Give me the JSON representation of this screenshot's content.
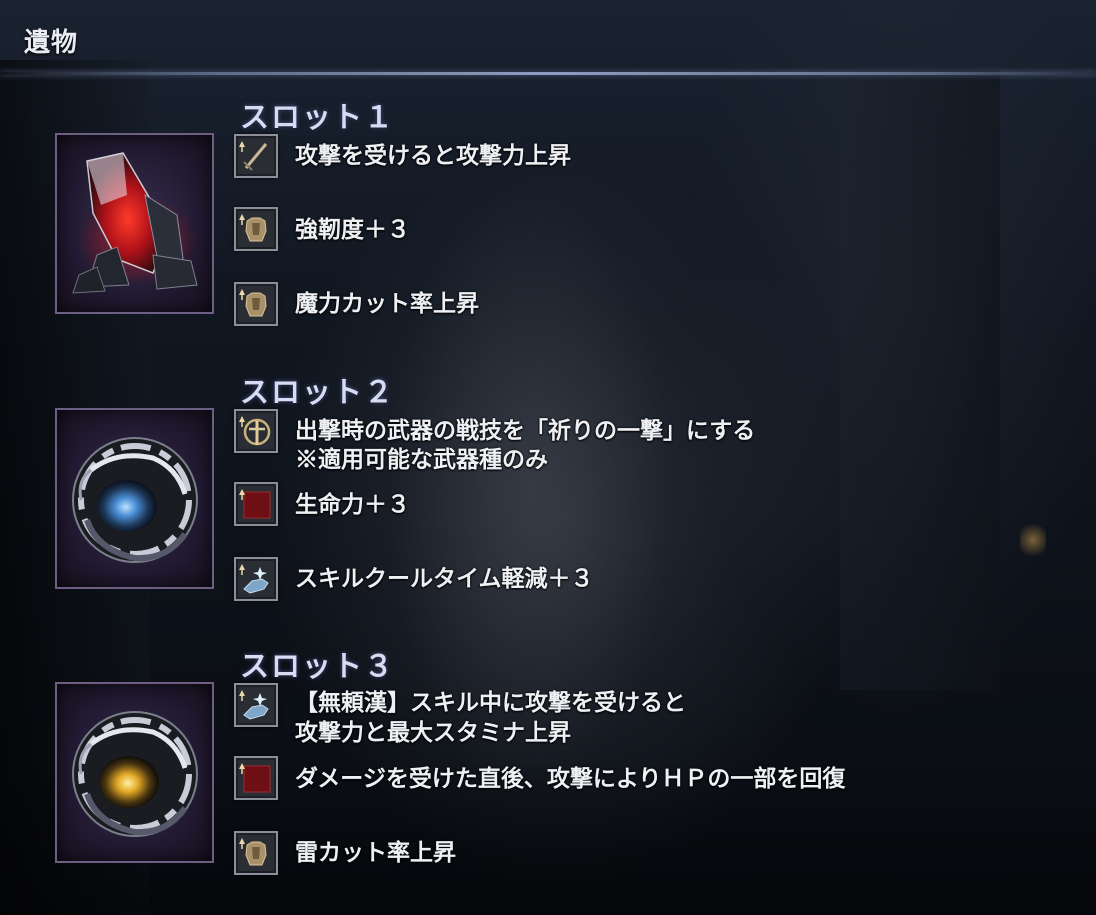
{
  "header": {
    "title": "遺物"
  },
  "colors": {
    "slot_title": "#d7dcf4",
    "text": "#eef0f4",
    "frame_border": "#6d5f84",
    "icon_border": "#8c8f98",
    "rule": "#aabee6"
  },
  "slots": [
    {
      "title": "スロット１",
      "relic_icon": "red-crystal-relic-icon",
      "effects": [
        {
          "icon": "sword-up-icon",
          "text": "攻撃を受けると攻撃力上昇"
        },
        {
          "icon": "armor-up-icon",
          "text": "強靭度＋３"
        },
        {
          "icon": "armor-up-icon",
          "text": "魔力カット率上昇"
        }
      ]
    },
    {
      "title": "スロット２",
      "relic_icon": "blue-orb-relic-icon",
      "effects": [
        {
          "icon": "skill-emblem-icon",
          "text": "出撃時の武器の戦技を「祈りの一撃」にする",
          "note": "※適用可能な武器種のみ"
        },
        {
          "icon": "red-stat-icon",
          "text": "生命力＋３"
        },
        {
          "icon": "skill-hand-icon",
          "text": "スキルクールタイム軽減＋３"
        }
      ]
    },
    {
      "title": "スロット３",
      "relic_icon": "yellow-orb-relic-icon",
      "effects": [
        {
          "icon": "skill-hand-icon",
          "text": "【無頼漢】スキル中に攻撃を受けると",
          "note": "攻撃力と最大スタミナ上昇"
        },
        {
          "icon": "red-stat-icon",
          "text": "ダメージを受けた直後、攻撃によりＨＰの一部を回復"
        },
        {
          "icon": "armor-up-icon",
          "text": "雷カット率上昇"
        }
      ]
    }
  ]
}
